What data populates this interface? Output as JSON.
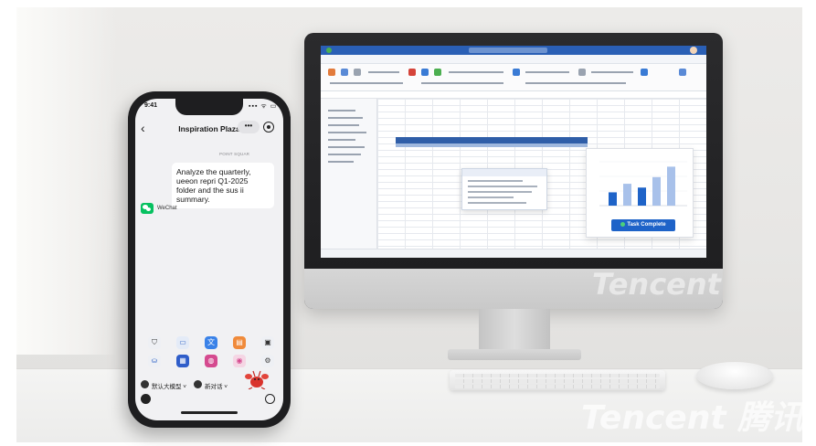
{
  "phone": {
    "status_time": "9:41",
    "status_icons": "▪▪▪ ᯤ ▭",
    "back_icon": "‹",
    "title": "Inspiration Plaza",
    "more_label": "•••",
    "chat_time": "POINT SQUAR",
    "message": "Analyze the quarterly, ueeon repri Q1-2025 folder and the sus ii summary.",
    "sender_label": "WeChat",
    "toolbar_left": "默认大模型 ˅",
    "toolbar_right": "新对话 ˅",
    "apps_row1": [
      "bag-icon",
      "window-icon",
      "translate-icon",
      "chart-icon",
      "doc-icon"
    ],
    "apps_row2": [
      "bag2-icon",
      "calendar-icon",
      "pin-icon",
      "photo-icon",
      "gear-icon"
    ]
  },
  "monitor": {
    "task_label": "Task Complete",
    "chart_values": [
      0.28,
      0.46,
      0.38,
      0.6,
      0.82
    ]
  },
  "watermarks": {
    "monitor": "Tencent",
    "desk": "Tencent 腾讯"
  }
}
